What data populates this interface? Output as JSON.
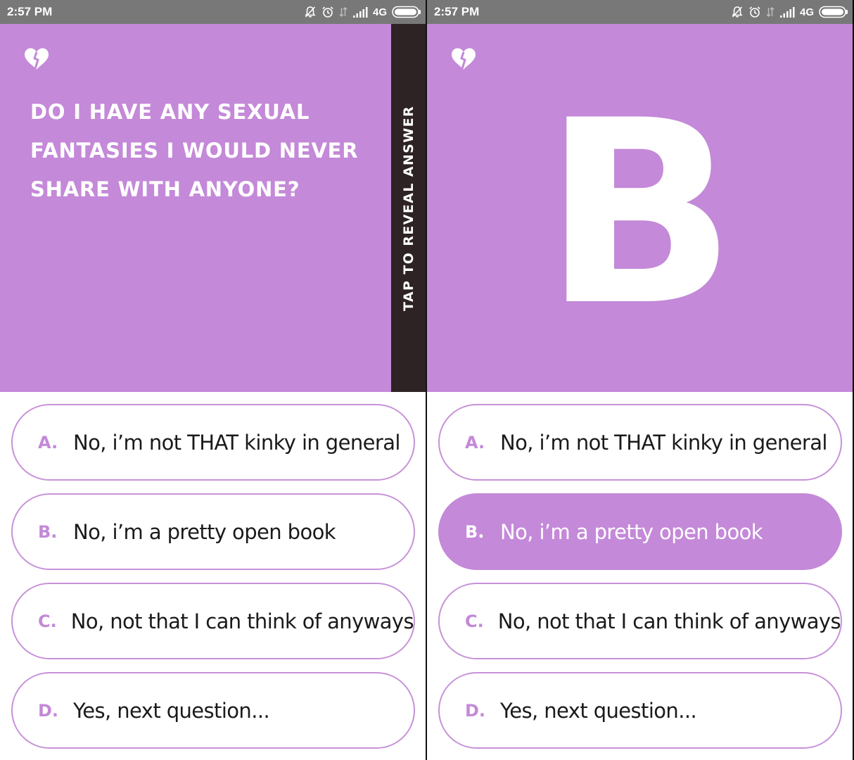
{
  "status": {
    "time": "2:57 PM",
    "network": "4G"
  },
  "question": "Do I have any sexual fantasies I would never share with anyone?",
  "reveal_label": "TAP TO REVEAL ANSWER",
  "answer_letter": "B",
  "options": [
    {
      "letter": "A.",
      "text": "No, i’m not THAT kinky in general"
    },
    {
      "letter": "B.",
      "text": "No, i’m a pretty open book"
    },
    {
      "letter": "C.",
      "text": "No, not that I can think of anyways"
    },
    {
      "letter": "D.",
      "text": "Yes, next question..."
    }
  ],
  "selected_option": "B.",
  "colors": {
    "card": "#c489d8",
    "strip": "#2d2325",
    "status_bar": "#787878",
    "option_border": "#c792d8"
  },
  "icons": {
    "logo": "heart-icon"
  }
}
